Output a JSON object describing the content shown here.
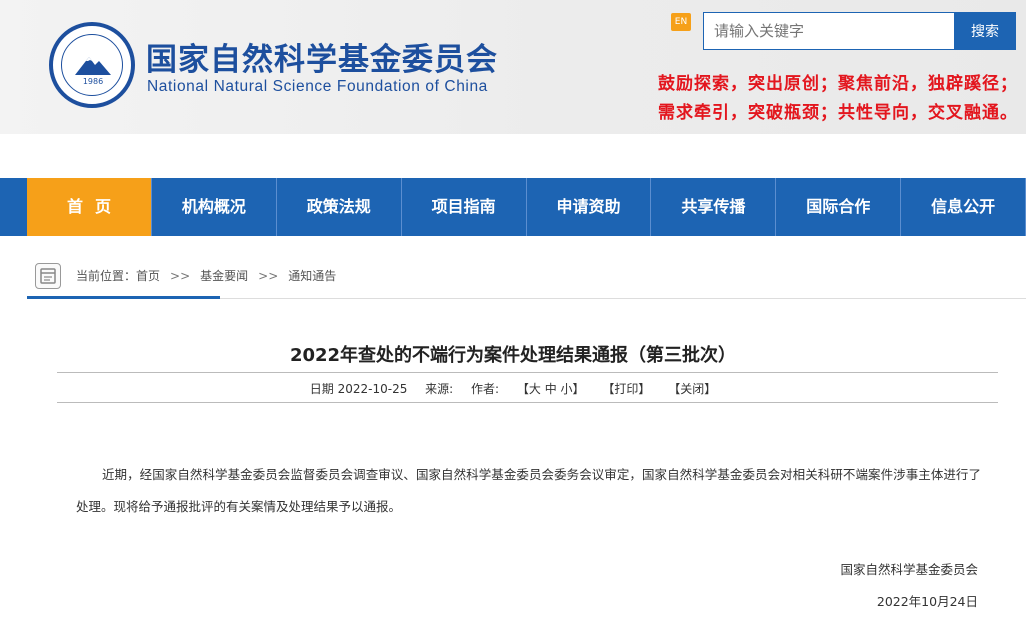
{
  "header": {
    "title_cn": "国家自然科学基金委员会",
    "title_en": "National Natural Science Foundation of China",
    "logo_year": "1986",
    "en_label": "EN",
    "search_placeholder": "请输入关键字",
    "search_button": "搜索",
    "slogan_line1": "鼓励探索，突出原创；聚焦前沿，独辟蹊径；",
    "slogan_line2": "需求牵引，突破瓶颈；共性导向，交叉融通。",
    "slogan_color": "#e3161e",
    "brand_color": "#1d4f9e"
  },
  "nav": {
    "items": [
      {
        "label": "首页",
        "active": true
      },
      {
        "label": "机构概况"
      },
      {
        "label": "政策法规"
      },
      {
        "label": "项目指南"
      },
      {
        "label": "申请资助"
      },
      {
        "label": "共享传播"
      },
      {
        "label": "国际合作"
      },
      {
        "label": "信息公开"
      }
    ],
    "bg_color": "#1d64b3",
    "active_color": "#f6a019"
  },
  "breadcrumb": {
    "prefix": "当前位置：",
    "items": [
      "首页",
      "基金要闻",
      "通知通告"
    ],
    "separator": ">>"
  },
  "article": {
    "title": "2022年查处的不端行为案件处理结果通报（第三批次）",
    "date_label": "日期",
    "date": "2022-10-25",
    "source_label": "来源:",
    "author_label": "作者:",
    "font_size_label": "【大 中 小】",
    "print_label": "【打印】",
    "close_label": "【关闭】",
    "body": "近期，经国家自然科学基金委员会监督委员会调查审议、国家自然科学基金委员会委务会议审定，国家自然科学基金委员会对相关科研不端案件涉事主体进行了处理。现将给予通报批评的有关案情及处理结果予以通报。",
    "signature_org": "国家自然科学基金委员会",
    "signature_date": "2022年10月24日"
  }
}
